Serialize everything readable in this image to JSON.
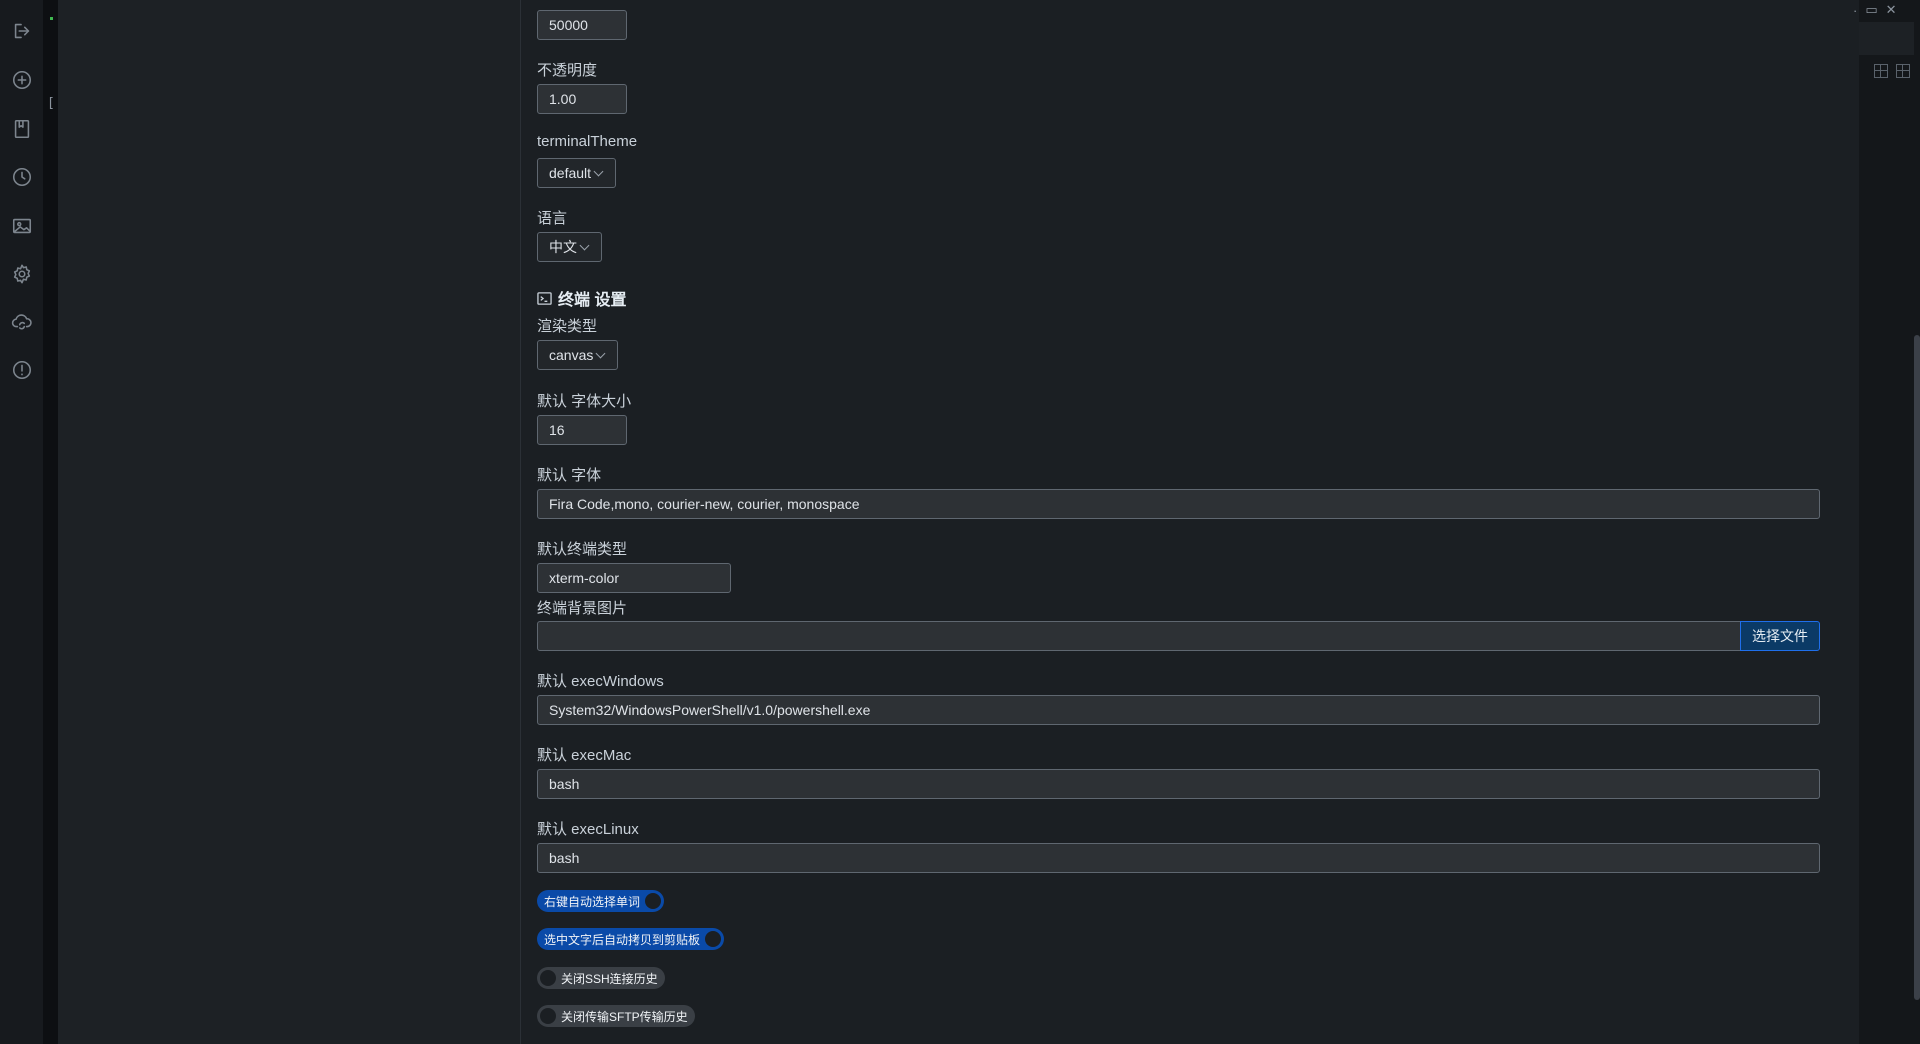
{
  "sidebar": {
    "items": [
      {
        "icon": "exit-icon"
      },
      {
        "icon": "add-circle-icon"
      },
      {
        "icon": "bookmark-icon"
      },
      {
        "icon": "clock-history-icon"
      },
      {
        "icon": "image-icon"
      },
      {
        "icon": "gear-icon"
      },
      {
        "icon": "cloud-sync-icon"
      },
      {
        "icon": "info-icon"
      }
    ],
    "strip_bracket": "["
  },
  "general": {
    "scrollback_value": "50000",
    "opacity_label": "不透明度",
    "opacity_value": "1.00",
    "theme_label": "terminalTheme",
    "theme_value": "default",
    "language_label": "语言",
    "language_value": "中文"
  },
  "terminal": {
    "section_title": "终端 设置",
    "render_label": "渲染类型",
    "render_value": "canvas",
    "font_size_label": "默认 字体大小",
    "font_size_value": "16",
    "font_label": "默认 字体",
    "font_value": "Fira Code,mono, courier-new, courier, monospace",
    "term_type_label": "默认终端类型",
    "term_type_value": "xterm-color",
    "bg_image_label": "终端背景图片",
    "bg_image_value": "",
    "choose_file": "选择文件",
    "exec_windows_label": "默认 execWindows",
    "exec_windows_value": "System32/WindowsPowerShell/v1.0/powershell.exe",
    "exec_mac_label": "默认 execMac",
    "exec_mac_value": "bash",
    "exec_linux_label": "默认 execLinux",
    "exec_linux_value": "bash",
    "toggles": [
      {
        "label": "右键自动选择单词",
        "on": true
      },
      {
        "label": "选中文字后自动拷贝到剪贴板",
        "on": true
      },
      {
        "label": "关闭SSH连接历史",
        "on": false
      },
      {
        "label": "关闭传输SFTP传输历史",
        "on": false
      }
    ]
  },
  "colors": {
    "accent": "#0a4aa8",
    "button": "#0b3a66",
    "background": "#1b1f23"
  }
}
